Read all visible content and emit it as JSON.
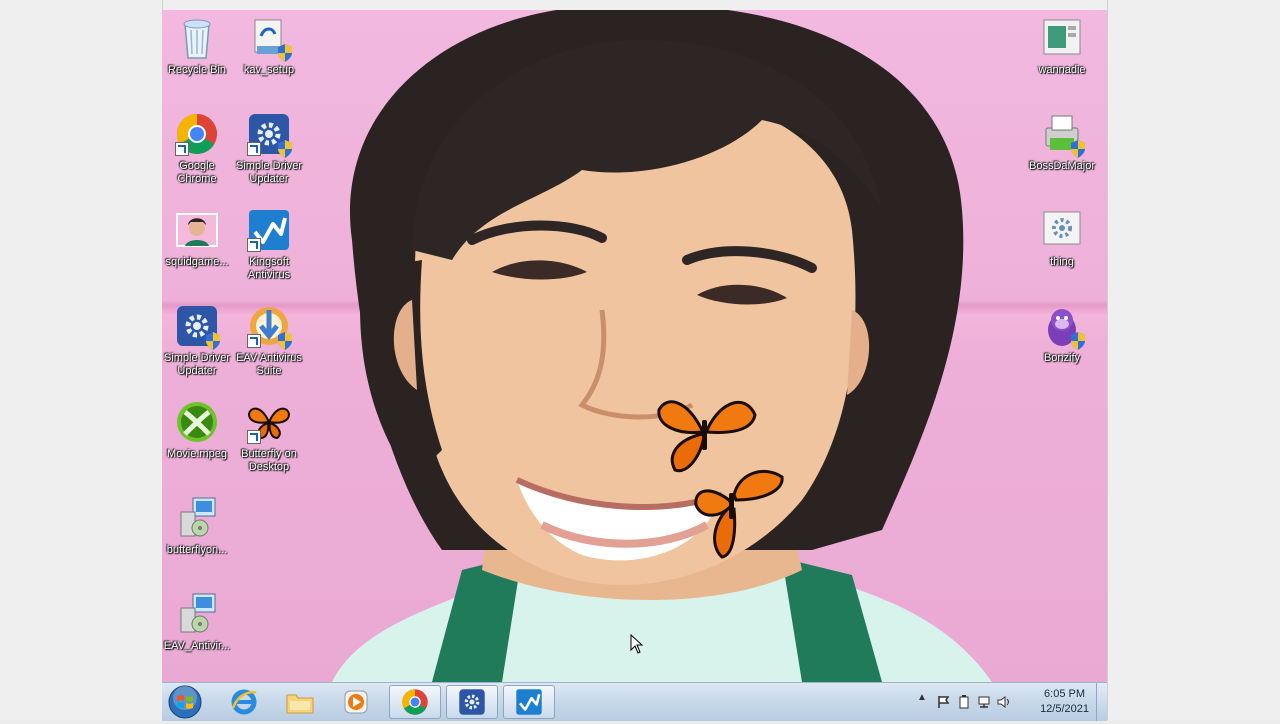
{
  "desktop": {
    "icons": [
      {
        "name": "recycle-bin",
        "label": "Recycle Bin",
        "icon": "recycle-bin-icon"
      },
      {
        "name": "kav-setup",
        "label": "kav_setup",
        "icon": "installer-icon"
      },
      {
        "name": "google-chrome",
        "label": "Google\nChrome",
        "icon": "chrome-icon"
      },
      {
        "name": "simple-driver-updater-1",
        "label": "Simple Driver\nUpdater",
        "icon": "gear-icon"
      },
      {
        "name": "squidgame",
        "label": "squidgame...",
        "icon": "photo-icon"
      },
      {
        "name": "kingsoft-antivirus",
        "label": "Kingsoft\nAntivirus",
        "icon": "kingsoft-icon"
      },
      {
        "name": "simple-driver-updater-2",
        "label": "Simple Driver\nUpdater",
        "icon": "gear-icon"
      },
      {
        "name": "eav-antivirus-suite",
        "label": "EAV Antivirus\nSuite",
        "icon": "eav-icon"
      },
      {
        "name": "movie-mpeg",
        "label": "Movie.mpeg",
        "icon": "xbox-icon"
      },
      {
        "name": "butterfly-on-desktop",
        "label": "Butterfly on\nDesktop",
        "icon": "butterfly-icon"
      },
      {
        "name": "butterflyon",
        "label": "butterflyon...",
        "icon": "setup-icon"
      },
      {
        "name": "eav-antivirus-setup",
        "label": "EAV_Antivir...",
        "icon": "setup-icon"
      },
      {
        "name": "wannadie",
        "label": "wannadie",
        "icon": "window-icon"
      },
      {
        "name": "bossdamajor",
        "label": "BossDaMajor",
        "icon": "printer-icon"
      },
      {
        "name": "thing",
        "label": "thing",
        "icon": "gear-icon"
      },
      {
        "name": "bonzify",
        "label": "Bonzify",
        "icon": "bonzi-icon"
      }
    ]
  },
  "taskbar": {
    "pinned": [
      {
        "name": "internet-explorer",
        "icon": "ie-icon"
      },
      {
        "name": "windows-explorer",
        "icon": "folder-icon"
      },
      {
        "name": "media-player",
        "icon": "media-player-icon"
      },
      {
        "name": "google-chrome",
        "icon": "chrome-icon"
      },
      {
        "name": "simple-driver-updater",
        "icon": "gear-icon"
      },
      {
        "name": "kingsoft-antivirus",
        "icon": "kingsoft-icon"
      }
    ],
    "clock": {
      "time": "6:05 PM",
      "date": "12/5/2021"
    },
    "tray_expand": "▲"
  },
  "colors": {
    "wallpaper_pink": "#f0b4dc",
    "taskbar": "#c9d9ea",
    "butterfly_orange": "#f07a10"
  }
}
